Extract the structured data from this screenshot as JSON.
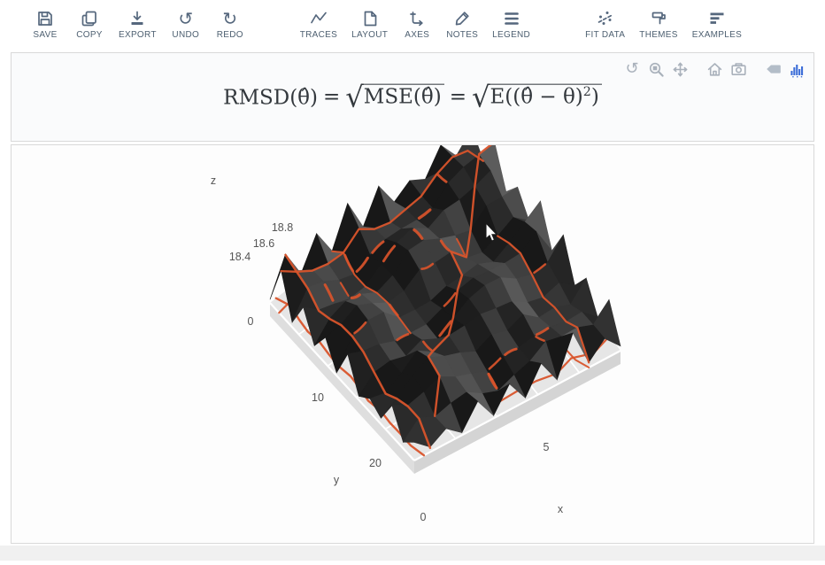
{
  "toolbar": {
    "glyphs": {
      "undo": "↺",
      "redo": "↻"
    },
    "groups": [
      {
        "items": [
          {
            "label": "SAVE"
          },
          {
            "label": "COPY"
          },
          {
            "label": "EXPORT"
          },
          {
            "label": "UNDO"
          },
          {
            "label": "REDO"
          }
        ]
      },
      {
        "items": [
          {
            "label": "TRACES"
          },
          {
            "label": "LAYOUT"
          },
          {
            "label": "AXES"
          },
          {
            "label": "NOTES"
          },
          {
            "label": "LEGEND"
          }
        ]
      },
      {
        "items": [
          {
            "label": "FIT DATA"
          },
          {
            "label": "THEMES"
          },
          {
            "label": "EXAMPLES"
          }
        ]
      }
    ]
  },
  "annotation": {
    "sqrt": "√",
    "lhs": "RMSD(θ̂)",
    "eq1": "=",
    "rad1": "MSE(θ̂)",
    "eq2": "=",
    "rad2_pre": "E((θ̂ − θ)",
    "rad2_sup": "2",
    "rad2_post": ")"
  },
  "modebar": {
    "reset_glyph": "↺",
    "icons": [
      "reset-camera",
      "zoom-3d",
      "pan-3d",
      "home",
      "camera-snapshot",
      "edit-tag",
      "plotly-logo"
    ]
  },
  "chart_data": {
    "type": "surface",
    "title": "RMSD(θ̂) = √MSE(θ̂) = √E((θ̂ − θ)²)",
    "axes": {
      "x": {
        "label": "x",
        "tick_labels": [
          "0",
          "5"
        ],
        "tick_values": [
          0,
          5
        ],
        "range_est": [
          0,
          9
        ]
      },
      "y": {
        "label": "y",
        "tick_labels": [
          "0",
          "10",
          "20"
        ],
        "tick_values": [
          0,
          10,
          20
        ],
        "range_est": [
          0,
          25
        ]
      },
      "z": {
        "label": "z",
        "tick_labels": [
          "18.4",
          "18.6",
          "18.8"
        ],
        "tick_values": [
          18.4,
          18.6,
          18.8
        ],
        "range_est": [
          18.3,
          18.9
        ]
      }
    },
    "surface_fill": "#2f2f2f",
    "surface_fill_light": "#5c5c5c",
    "contour_color": "#d9542b",
    "floor_color": "#e6e6e6",
    "grid_color": "#ffffff",
    "legend": "off",
    "description": "Jagged dark-gray 3D surface of RMSD values with orange contour lines draped over the surface and projected onto a light-gray floor pane; viewed from an oblique angle with y axis running to lower-left and x axis to lower-right."
  }
}
